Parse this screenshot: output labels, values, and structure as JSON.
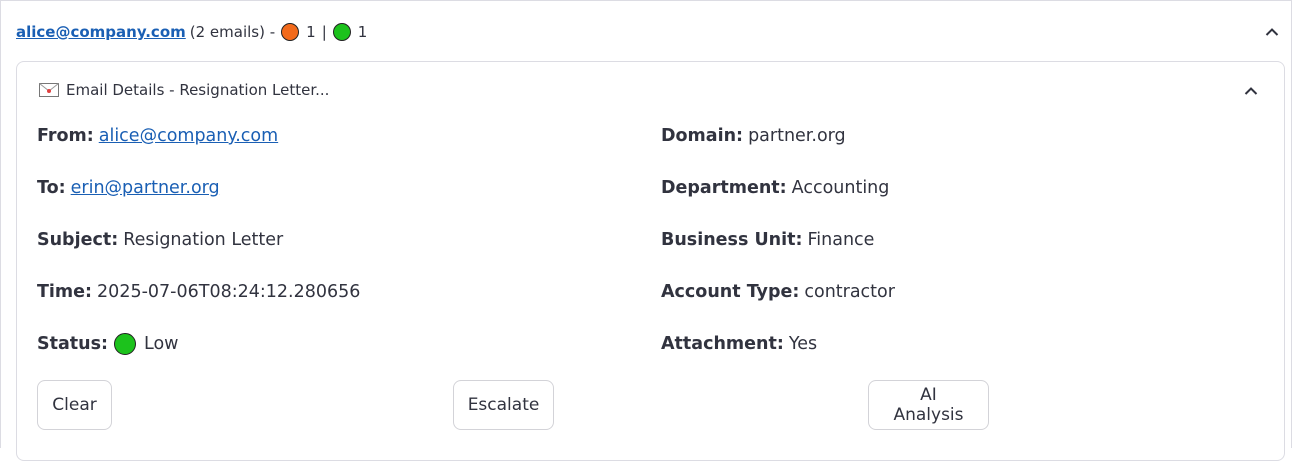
{
  "group": {
    "email": "alice@company.com",
    "count_text": "(2 emails) -",
    "orange_count": "1",
    "separator": "|",
    "green_count": "1",
    "colors": {
      "orange": "#f26a1b",
      "green": "#1cc21c"
    }
  },
  "details": {
    "title": "Email Details - Resignation Letter...",
    "left": [
      {
        "label": "From:",
        "value": "alice@company.com",
        "link": true
      },
      {
        "label": "To:",
        "value": "erin@partner.org",
        "link": true
      },
      {
        "label": "Subject:",
        "value": "Resignation Letter",
        "link": false
      },
      {
        "label": "Time:",
        "value": "2025-07-06T08:24:12.280656",
        "link": false
      },
      {
        "label": "Status:",
        "value": "Low",
        "link": false
      }
    ],
    "right": [
      {
        "label": "Domain:",
        "value": "partner.org"
      },
      {
        "label": "Department:",
        "value": "Accounting"
      },
      {
        "label": "Business Unit:",
        "value": "Finance"
      },
      {
        "label": "Account Type:",
        "value": "contractor"
      },
      {
        "label": "Attachment:",
        "value": "Yes"
      }
    ],
    "buttons": {
      "clear": "Clear",
      "escalate": "Escalate",
      "ai": "AI Analysis"
    }
  }
}
